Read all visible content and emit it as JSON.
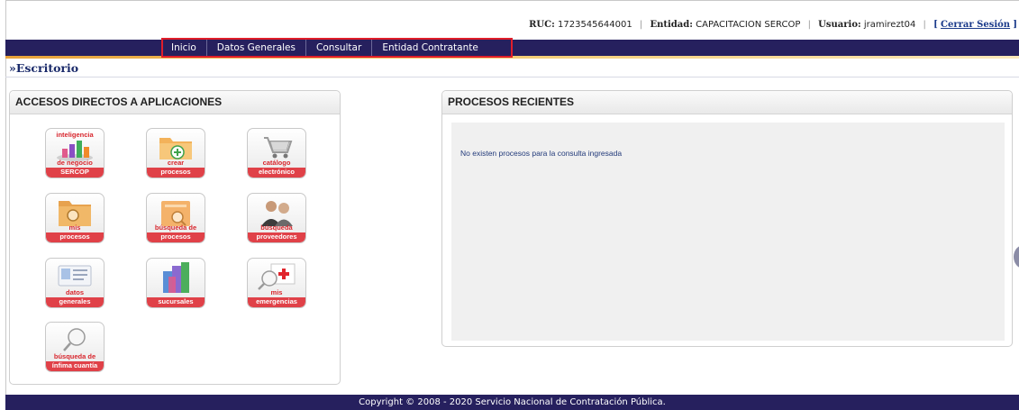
{
  "userbar": {
    "ruc_label": "RUC:",
    "ruc_value": "1723545644001",
    "entidad_label": "Entidad:",
    "entidad_value": "CAPACITACION SERCOP",
    "usuario_label": "Usuario:",
    "usuario_value": "jramirezt04",
    "logout_open": "[",
    "logout_label": "Cerrar Sesión",
    "logout_close": "]"
  },
  "nav": {
    "items": [
      "Inicio",
      "Datos Generales",
      "Consultar",
      "Entidad Contratante"
    ]
  },
  "breadcrumb": "»Escritorio",
  "accesos": {
    "title": "ACCESOS DIRECTOS A APLICACIONES",
    "tiles": [
      {
        "top": "inteligencia",
        "line1": "de negocio",
        "line2": "SERCOP",
        "icon": "bar-chart-icon"
      },
      {
        "top": "",
        "line1": "crear",
        "line2": "procesos",
        "icon": "folder-add-icon"
      },
      {
        "top": "",
        "line1": "catálogo",
        "line2": "electrónico",
        "icon": "shopping-cart-icon"
      },
      {
        "top": "",
        "line1": "mis",
        "line2": "procesos",
        "icon": "folder-search-icon"
      },
      {
        "top": "",
        "line1": "búsqueda de",
        "line2": "procesos",
        "icon": "document-search-icon"
      },
      {
        "top": "",
        "line1": "búsqueda",
        "line2": "proveedores",
        "icon": "people-icon"
      },
      {
        "top": "",
        "line1": "datos",
        "line2": "generales",
        "icon": "id-card-icon"
      },
      {
        "top": "",
        "line1": "",
        "line2": "sucursales",
        "icon": "buildings-icon"
      },
      {
        "top": "",
        "line1": "mis",
        "line2": "emergencias",
        "icon": "emergency-search-icon"
      },
      {
        "top": "",
        "line1": "búsqueda de",
        "line2": "ínfima cuantía",
        "icon": "magnifier-icon"
      }
    ]
  },
  "procesos": {
    "title": "PROCESOS RECIENTES",
    "empty_message": "No existen procesos para la consulta ingresada"
  },
  "footer": "Copyright © 2008 - 2020 Servicio Nacional de Contratación Pública.",
  "colors": {
    "navbar": "#26205e",
    "highlight": "#e01e2a",
    "tile_band": "#e04148",
    "accent_orange": "#e8a23a"
  }
}
